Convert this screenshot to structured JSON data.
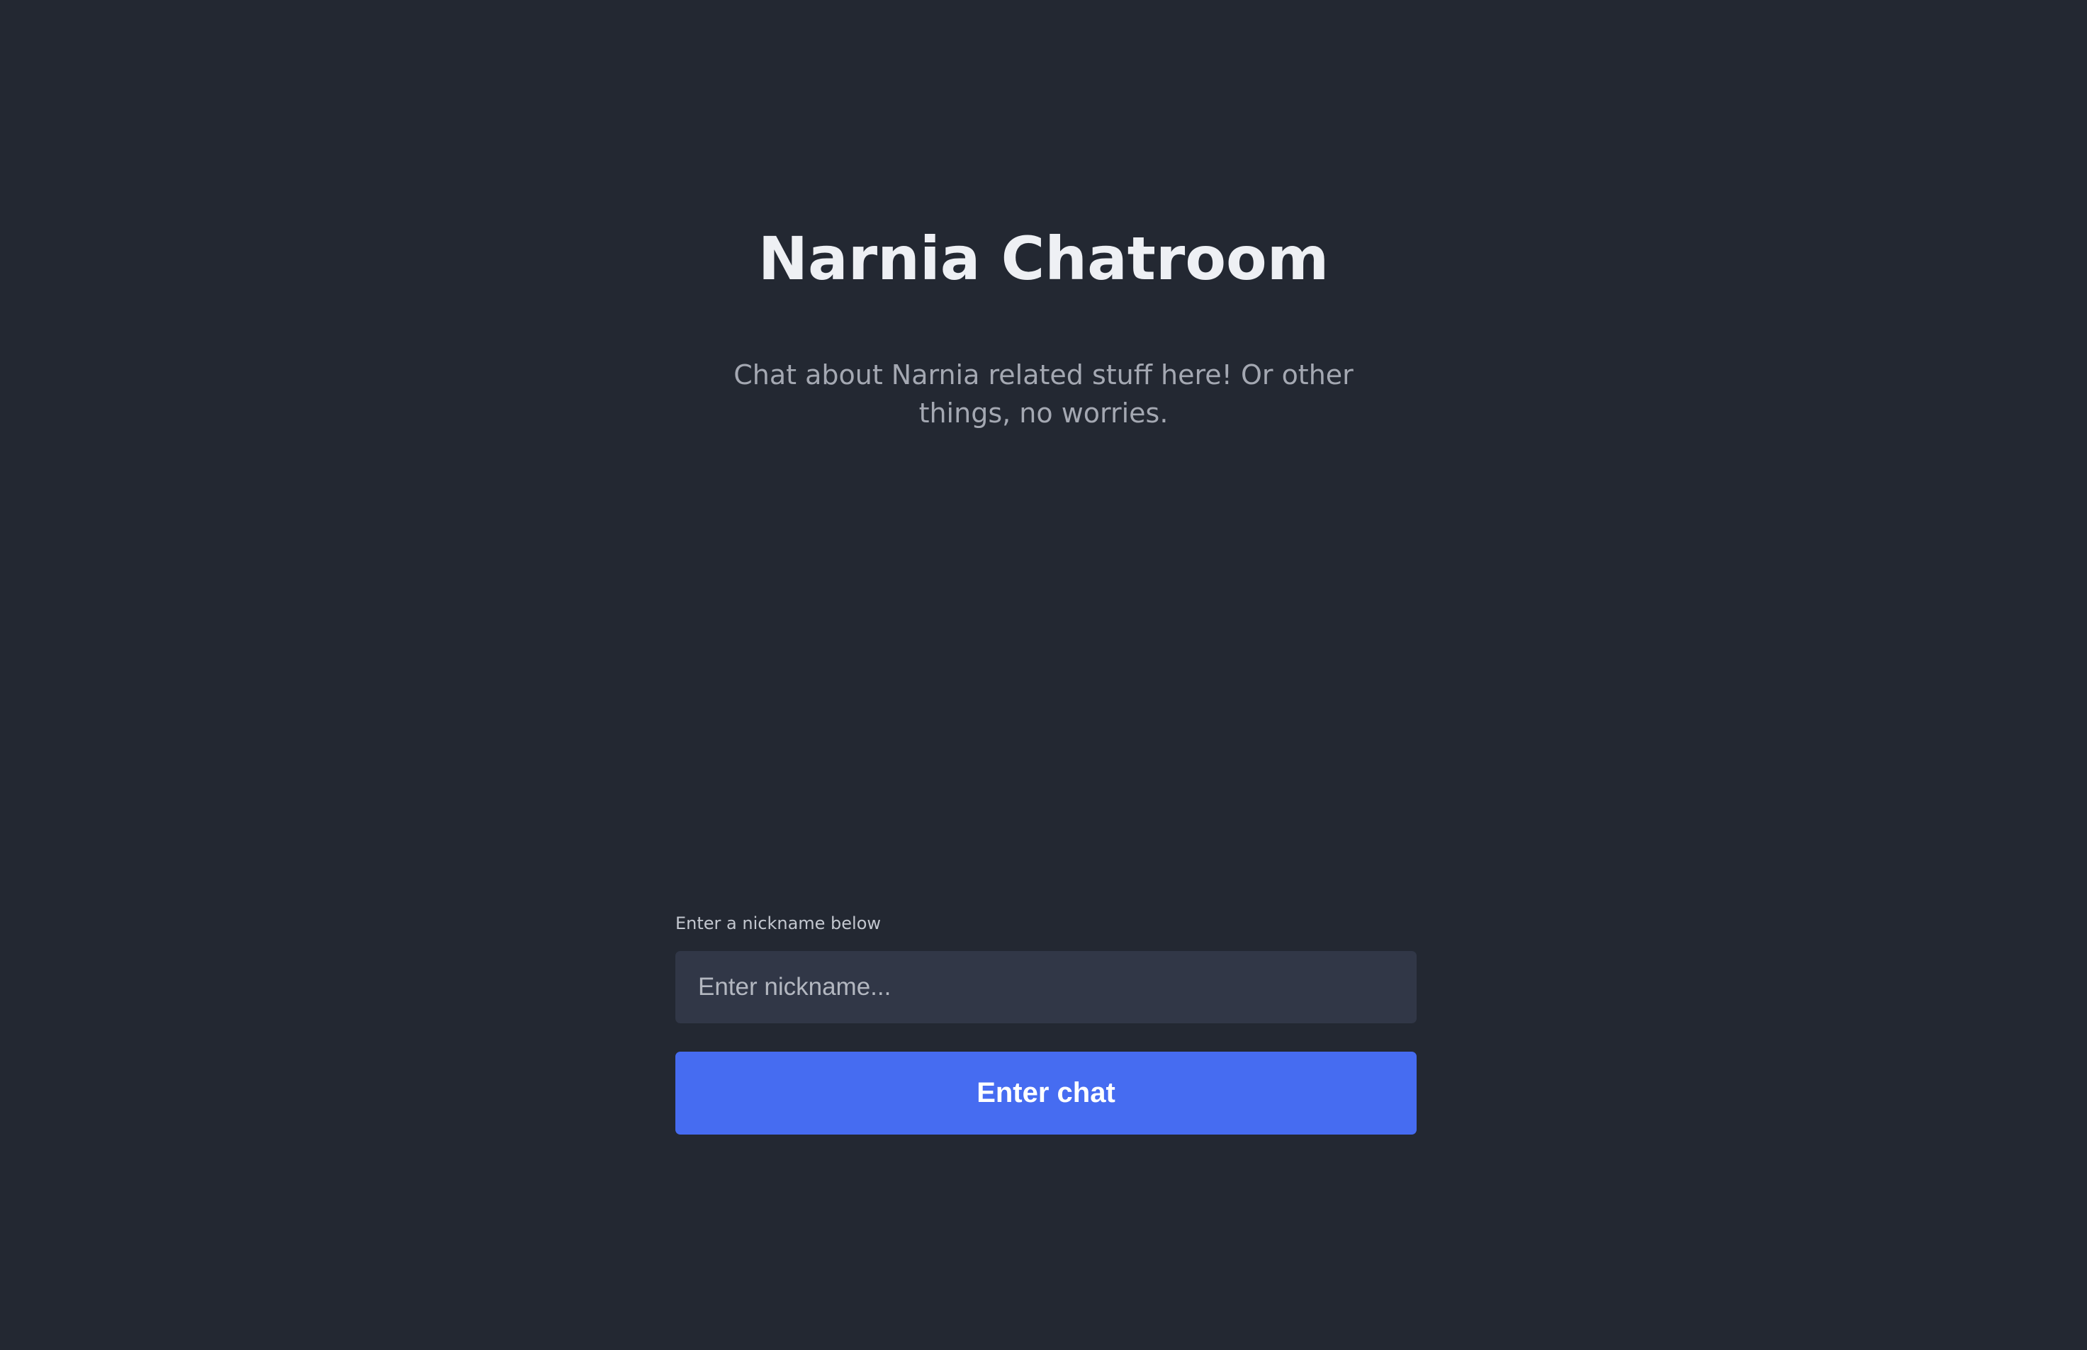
{
  "page": {
    "title": "Narnia Chatroom",
    "subtitle": "Chat about Narnia related stuff here! Or other things, no worries."
  },
  "nickname_form": {
    "label": "Enter a nickname below",
    "input_value": "",
    "input_placeholder": "Enter nickname...",
    "submit_label": "Enter chat"
  },
  "colors": {
    "background": "#232832",
    "title_text": "#eef0f4",
    "subtitle_text": "#a4a8b2",
    "input_background": "#313747",
    "button_accent": "#466cf1",
    "button_text": "#ffffff"
  }
}
